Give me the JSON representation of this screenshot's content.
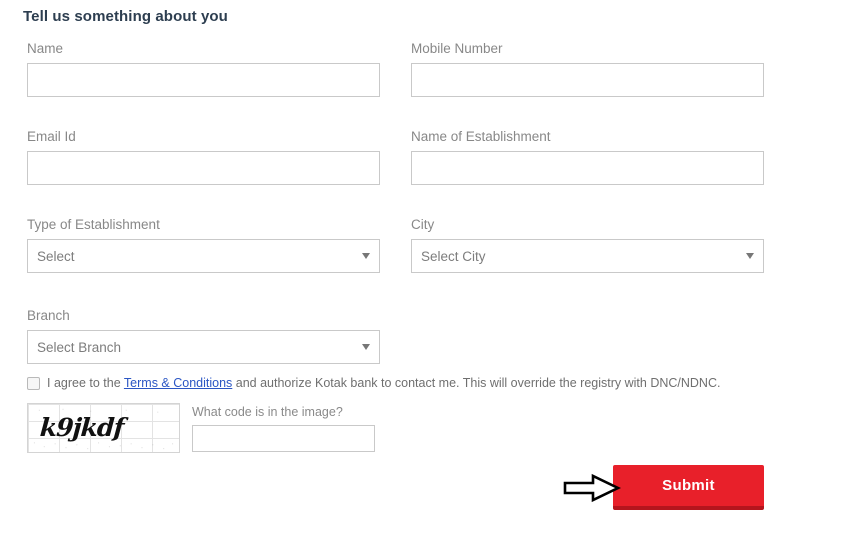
{
  "form": {
    "heading": "Tell us something about you",
    "fields": [
      {
        "label": "Name",
        "value": "",
        "placeholder": ""
      },
      {
        "label": "Mobile Number",
        "value": "",
        "placeholder": ""
      },
      {
        "label": "Email Id",
        "value": "",
        "placeholder": ""
      },
      {
        "label": "Name of Establishment",
        "value": "",
        "placeholder": ""
      }
    ],
    "selects": [
      {
        "label": "Type of Establishment",
        "value": "Select",
        "caret": "chevron-down-icon"
      },
      {
        "label": "City",
        "value": "Select City",
        "caret": "chevron-down-icon"
      },
      {
        "label": "Branch",
        "value": "Select Branch",
        "caret": "chevron-down-icon"
      }
    ],
    "consent": {
      "checked": false,
      "text_before": "I agree to the ",
      "link_text": "Terms & Conditions",
      "text_after": " and authorize Kotak bank to contact me. This will override the registry with DNC/NDNC."
    },
    "captcha": {
      "code": "k9jkdf",
      "prompt": "What code is in the image?",
      "answer": "",
      "placeholder": ""
    },
    "submit_label": "Submit"
  },
  "annotation": {
    "arrow": "right-arrow-pointer"
  },
  "colors": {
    "heading": "#2d3e50",
    "label": "#888888",
    "border": "#c9c9c9",
    "link": "#2b56c4",
    "submit_bg": "#e8202a",
    "submit_shadow": "#b5151d",
    "submit_text": "#ffffff"
  }
}
